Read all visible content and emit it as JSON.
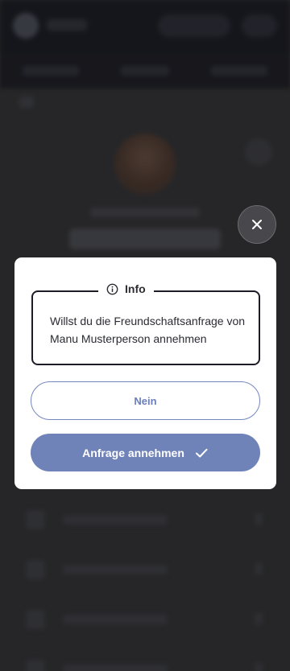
{
  "dialog": {
    "info_title": "Info",
    "message": "Willst du die Freundschaftsanfrage von Manu Musterperson annehmen",
    "decline_label": "Nein",
    "accept_label": "Anfrage annehmen"
  },
  "icons": {
    "close": "close-icon",
    "info": "info-icon",
    "accept": "checkmark-icon"
  },
  "colors": {
    "primary": "#7083b8",
    "primary_outline": "#7486c0",
    "info_border": "#1b1c26",
    "overlay_close": "#48484c"
  }
}
